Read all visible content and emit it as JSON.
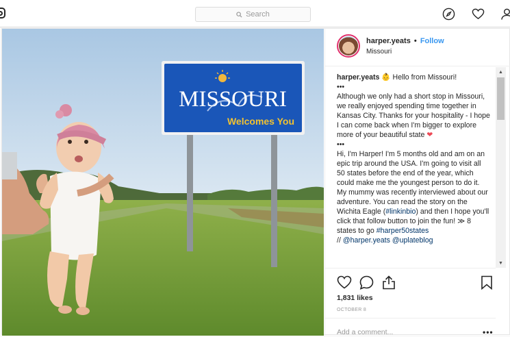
{
  "search": {
    "placeholder": "Search"
  },
  "post": {
    "username": "harper.yeats",
    "separator": "•",
    "follow_label": "Follow",
    "location": "Missouri",
    "sign": {
      "line1": "MISSOURI",
      "line2": "Welcomes You"
    },
    "caption": {
      "author": "harper.yeats",
      "greeting": "Hello from Missouri!",
      "dots1": "•••",
      "para1": "Although we only had a short stop in Missouri, we really enjoyed spending time together in Kansas City. Thanks for your hospitality - I hope I can come back when I'm bigger to explore more of your beautiful state",
      "dots2": "•••",
      "para2_a": "Hi, I'm Harper! I'm 5 months old and am on an epic trip around the USA. I'm going to visit all 50 states before the end of the year, which could make me the youngest person to do it. My mummy was recently interviewed about our adventure. You can read the story on the Wichita Eagle (",
      "hashtag1": "#linkinbio",
      "para2_b": ") and then I hope you'll click that follow button to join the fun! ≫ 8 states to go ",
      "hashtag2": "#harper50states",
      "credit_prefix": "// ",
      "mention1": "@harper.yeats",
      "mention2": "@uplateblog"
    },
    "likes": "1,831 likes",
    "date": "OCTOBER 8",
    "add_comment_placeholder": "Add a comment...",
    "more": "•••"
  },
  "colors": {
    "link": "#003569",
    "follow": "#3897f0",
    "heart": "#ed4956",
    "sign_blue": "#1a56b8"
  }
}
